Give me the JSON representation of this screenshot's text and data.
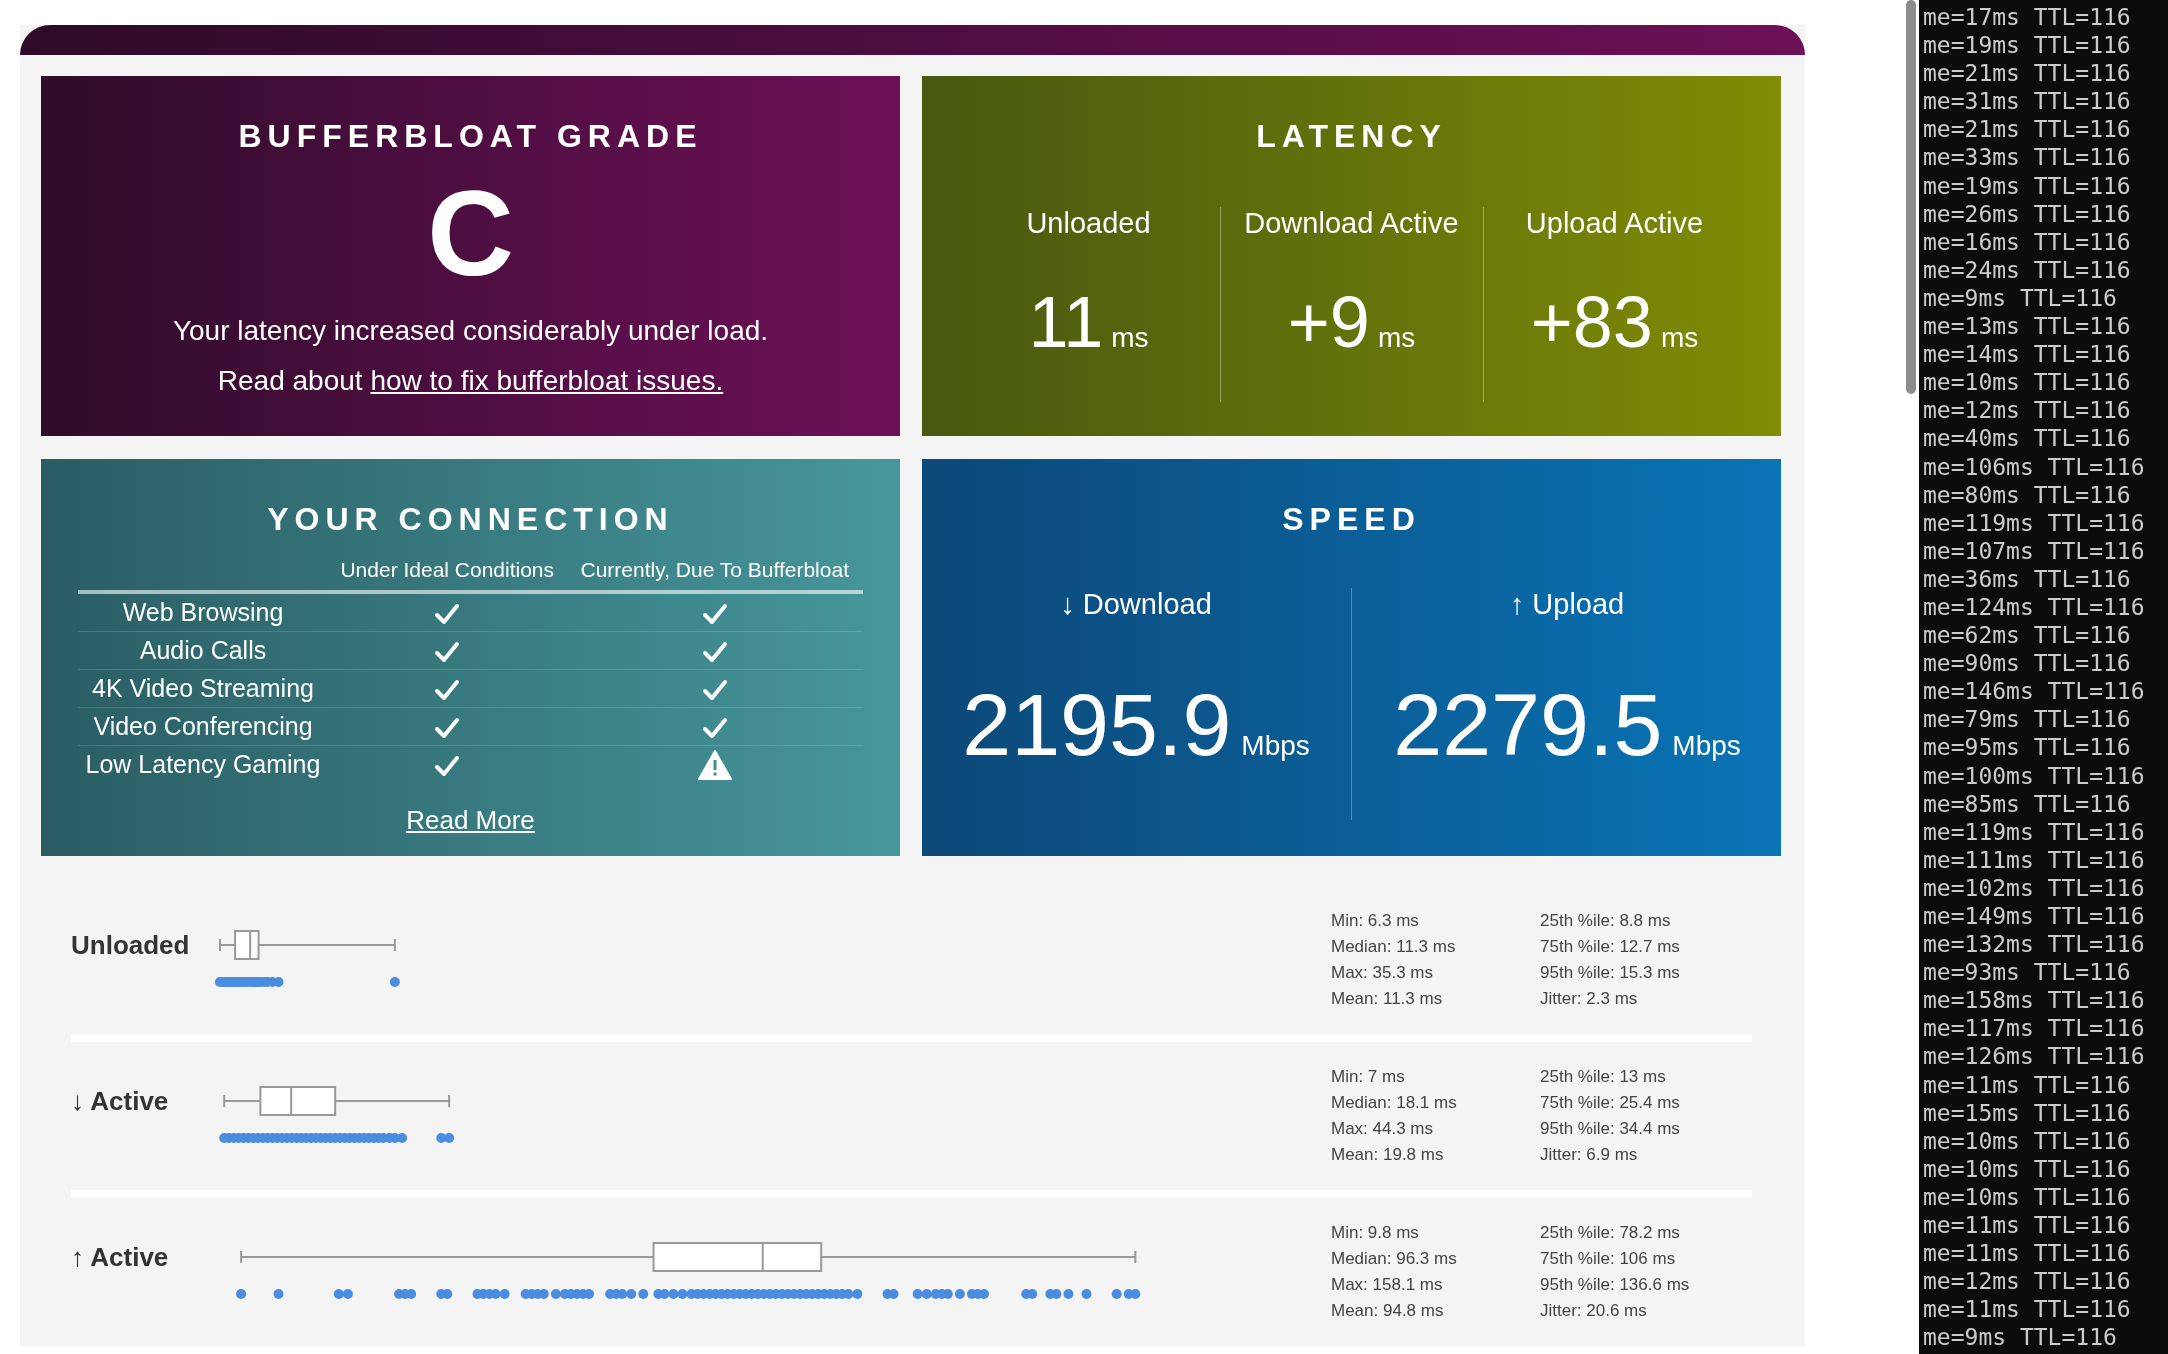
{
  "grade": {
    "title": "BUFFERBLOAT GRADE",
    "letter": "C",
    "message": "Your latency increased considerably under load.",
    "link_prefix": "Read about ",
    "link": "how to fix bufferbloat issues."
  },
  "latency": {
    "title": "LATENCY",
    "columns": [
      {
        "label": "Unloaded",
        "value": "11",
        "unit": "ms"
      },
      {
        "label": "Download Active",
        "value": "+9",
        "unit": "ms"
      },
      {
        "label": "Upload Active",
        "value": "+83",
        "unit": "ms"
      }
    ]
  },
  "connection": {
    "title": "YOUR CONNECTION",
    "columns": [
      "Under Ideal Conditions",
      "Currently, Due To Bufferbloat"
    ],
    "rows": [
      {
        "activity": "Web Browsing",
        "ideal_ok": true,
        "current_ok": true
      },
      {
        "activity": "Audio Calls",
        "ideal_ok": true,
        "current_ok": true
      },
      {
        "activity": "4K Video Streaming",
        "ideal_ok": true,
        "current_ok": true
      },
      {
        "activity": "Video Conferencing",
        "ideal_ok": true,
        "current_ok": true
      },
      {
        "activity": "Low Latency Gaming",
        "ideal_ok": true,
        "current_ok": false
      }
    ],
    "link": "Read More"
  },
  "speed": {
    "title": "SPEED",
    "columns": [
      {
        "label": "↓ Download",
        "value": "2195.9",
        "unit": "Mbps"
      },
      {
        "label": "↑ Upload",
        "value": "2279.5",
        "unit": "Mbps"
      }
    ]
  },
  "latency_details": [
    {
      "label": "Unloaded",
      "stats": [
        "Min: 6.3 ms",
        "Median: 11.3 ms",
        "Max: 35.3 ms",
        "Mean: 11.3 ms",
        "25th %ile: 8.8 ms",
        "75th %ile: 12.7 ms",
        "95th %ile: 15.3 ms",
        "Jitter: 2.3 ms"
      ]
    },
    {
      "label": "↓ Active",
      "stats": [
        "Min: 7 ms",
        "Median: 18.1 ms",
        "Max: 44.3 ms",
        "Mean: 19.8 ms",
        "25th %ile: 13 ms",
        "75th %ile: 25.4 ms",
        "95th %ile: 34.4 ms",
        "Jitter: 6.9 ms"
      ]
    },
    {
      "label": "↑ Active",
      "stats": [
        "Min: 9.8 ms",
        "Median: 96.3 ms",
        "Max: 158.1 ms",
        "Mean: 94.8 ms",
        "25th %ile: 78.2 ms",
        "75th %ile: 106 ms",
        "95th %ile: 136.6 ms",
        "Jitter: 20.6 ms"
      ]
    }
  ],
  "terminal": {
    "lines": [
      "me=17ms TTL=116",
      "me=19ms TTL=116",
      "me=21ms TTL=116",
      "me=31ms TTL=116",
      "me=21ms TTL=116",
      "me=33ms TTL=116",
      "me=19ms TTL=116",
      "me=26ms TTL=116",
      "me=16ms TTL=116",
      "me=24ms TTL=116",
      "me=9ms TTL=116",
      "me=13ms TTL=116",
      "me=14ms TTL=116",
      "me=10ms TTL=116",
      "me=12ms TTL=116",
      "me=40ms TTL=116",
      "me=106ms TTL=116",
      "me=80ms TTL=116",
      "me=119ms TTL=116",
      "me=107ms TTL=116",
      "me=36ms TTL=116",
      "me=124ms TTL=116",
      "me=62ms TTL=116",
      "me=90ms TTL=116",
      "me=146ms TTL=116",
      "me=79ms TTL=116",
      "me=95ms TTL=116",
      "me=100ms TTL=116",
      "me=85ms TTL=116",
      "me=119ms TTL=116",
      "me=111ms TTL=116",
      "me=102ms TTL=116",
      "me=149ms TTL=116",
      "me=132ms TTL=116",
      "me=93ms TTL=116",
      "me=158ms TTL=116",
      "me=117ms TTL=116",
      "me=126ms TTL=116",
      "me=11ms TTL=116",
      "me=15ms TTL=116",
      "me=10ms TTL=116",
      "me=10ms TTL=116",
      "me=10ms TTL=116",
      "me=11ms TTL=116",
      "me=11ms TTL=116",
      "me=12ms TTL=116",
      "me=11ms TTL=116",
      "me=9ms TTL=116"
    ]
  }
}
